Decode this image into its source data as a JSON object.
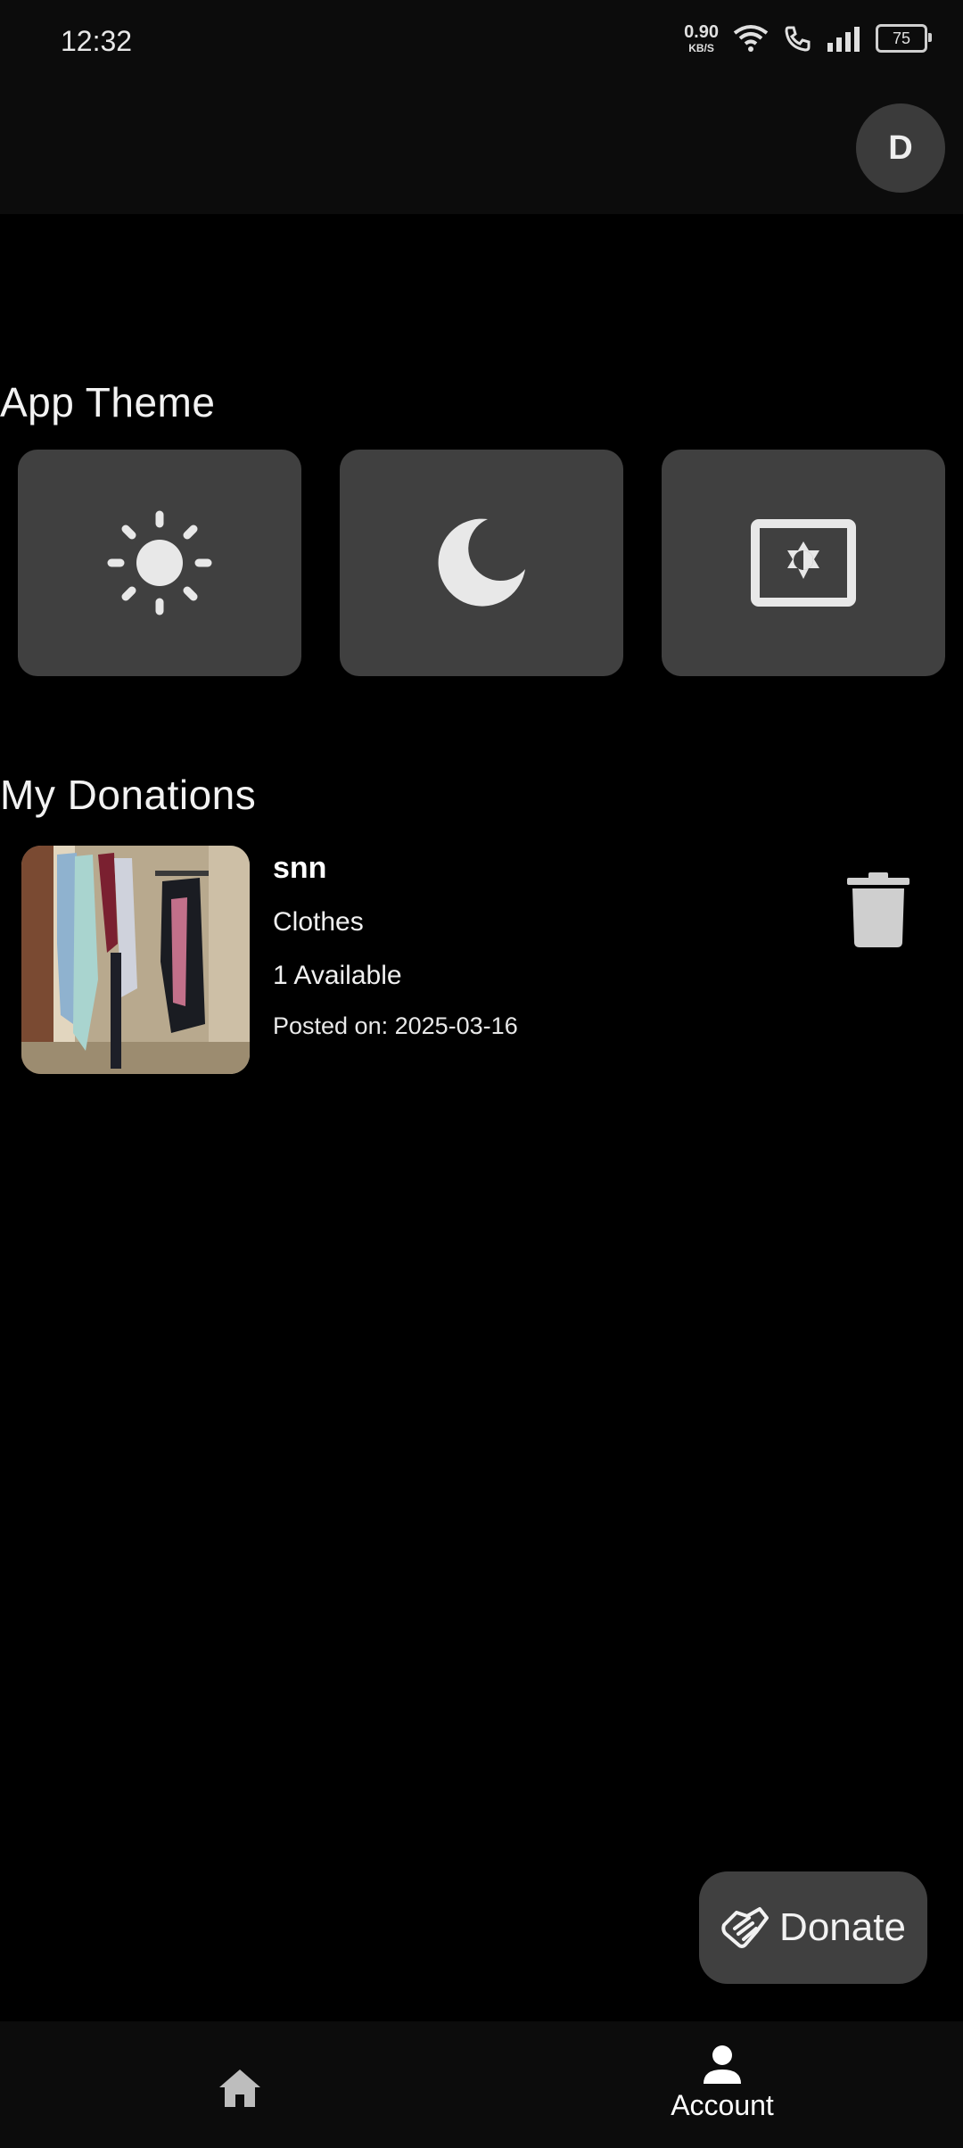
{
  "status": {
    "time": "12:32",
    "net_value": "0.90",
    "net_unit": "KB/S",
    "battery": "75"
  },
  "header": {
    "avatar_letter": "D"
  },
  "theme": {
    "title": "App Theme",
    "options": [
      {
        "icon": "sun-icon"
      },
      {
        "icon": "moon-icon"
      },
      {
        "icon": "brightness-auto-icon"
      }
    ]
  },
  "donations": {
    "title": "My Donations",
    "items": [
      {
        "name": "snn",
        "category": "Clothes",
        "available": "1 Available",
        "posted": "Posted on: 2025-03-16"
      }
    ]
  },
  "fab": {
    "label": "Donate",
    "icon": "handshake-icon"
  },
  "nav": {
    "home_icon": "home-icon",
    "account_label": "Account",
    "account_icon": "person-icon"
  },
  "colors": {
    "background": "#000000",
    "surface": "#404040",
    "bar": "#0c0c0c",
    "icon": "#e8e8e8"
  }
}
